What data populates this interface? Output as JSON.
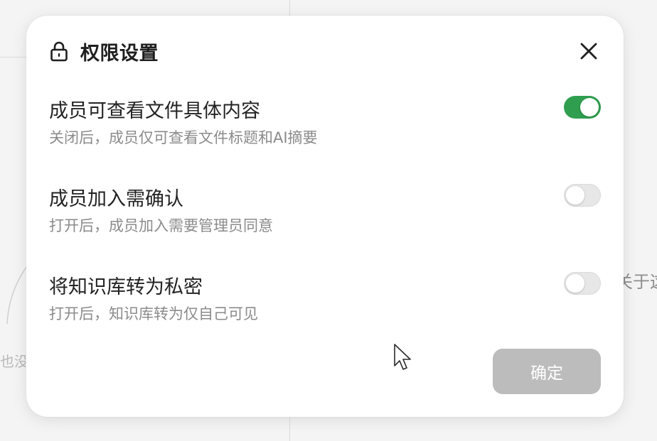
{
  "background": {
    "left_text": "也没",
    "right_text": "关于这"
  },
  "dialog": {
    "title": "权限设置",
    "title_icon": "lock-icon",
    "close_icon": "close-icon",
    "settings": [
      {
        "label": "成员可查看文件具体内容",
        "description": "关闭后，成员仅可查看文件标题和AI摘要",
        "enabled": true
      },
      {
        "label": "成员加入需确认",
        "description": "打开后，成员加入需要管理员同意",
        "enabled": false
      },
      {
        "label": "将知识库转为私密",
        "description": "打开后，知识库转为仅自己可见",
        "enabled": false
      }
    ],
    "confirm_label": "确定"
  },
  "colors": {
    "toggle_on": "#2f9e4f",
    "toggle_off": "#e7e7e7",
    "confirm_disabled": "#bcbcbc"
  }
}
